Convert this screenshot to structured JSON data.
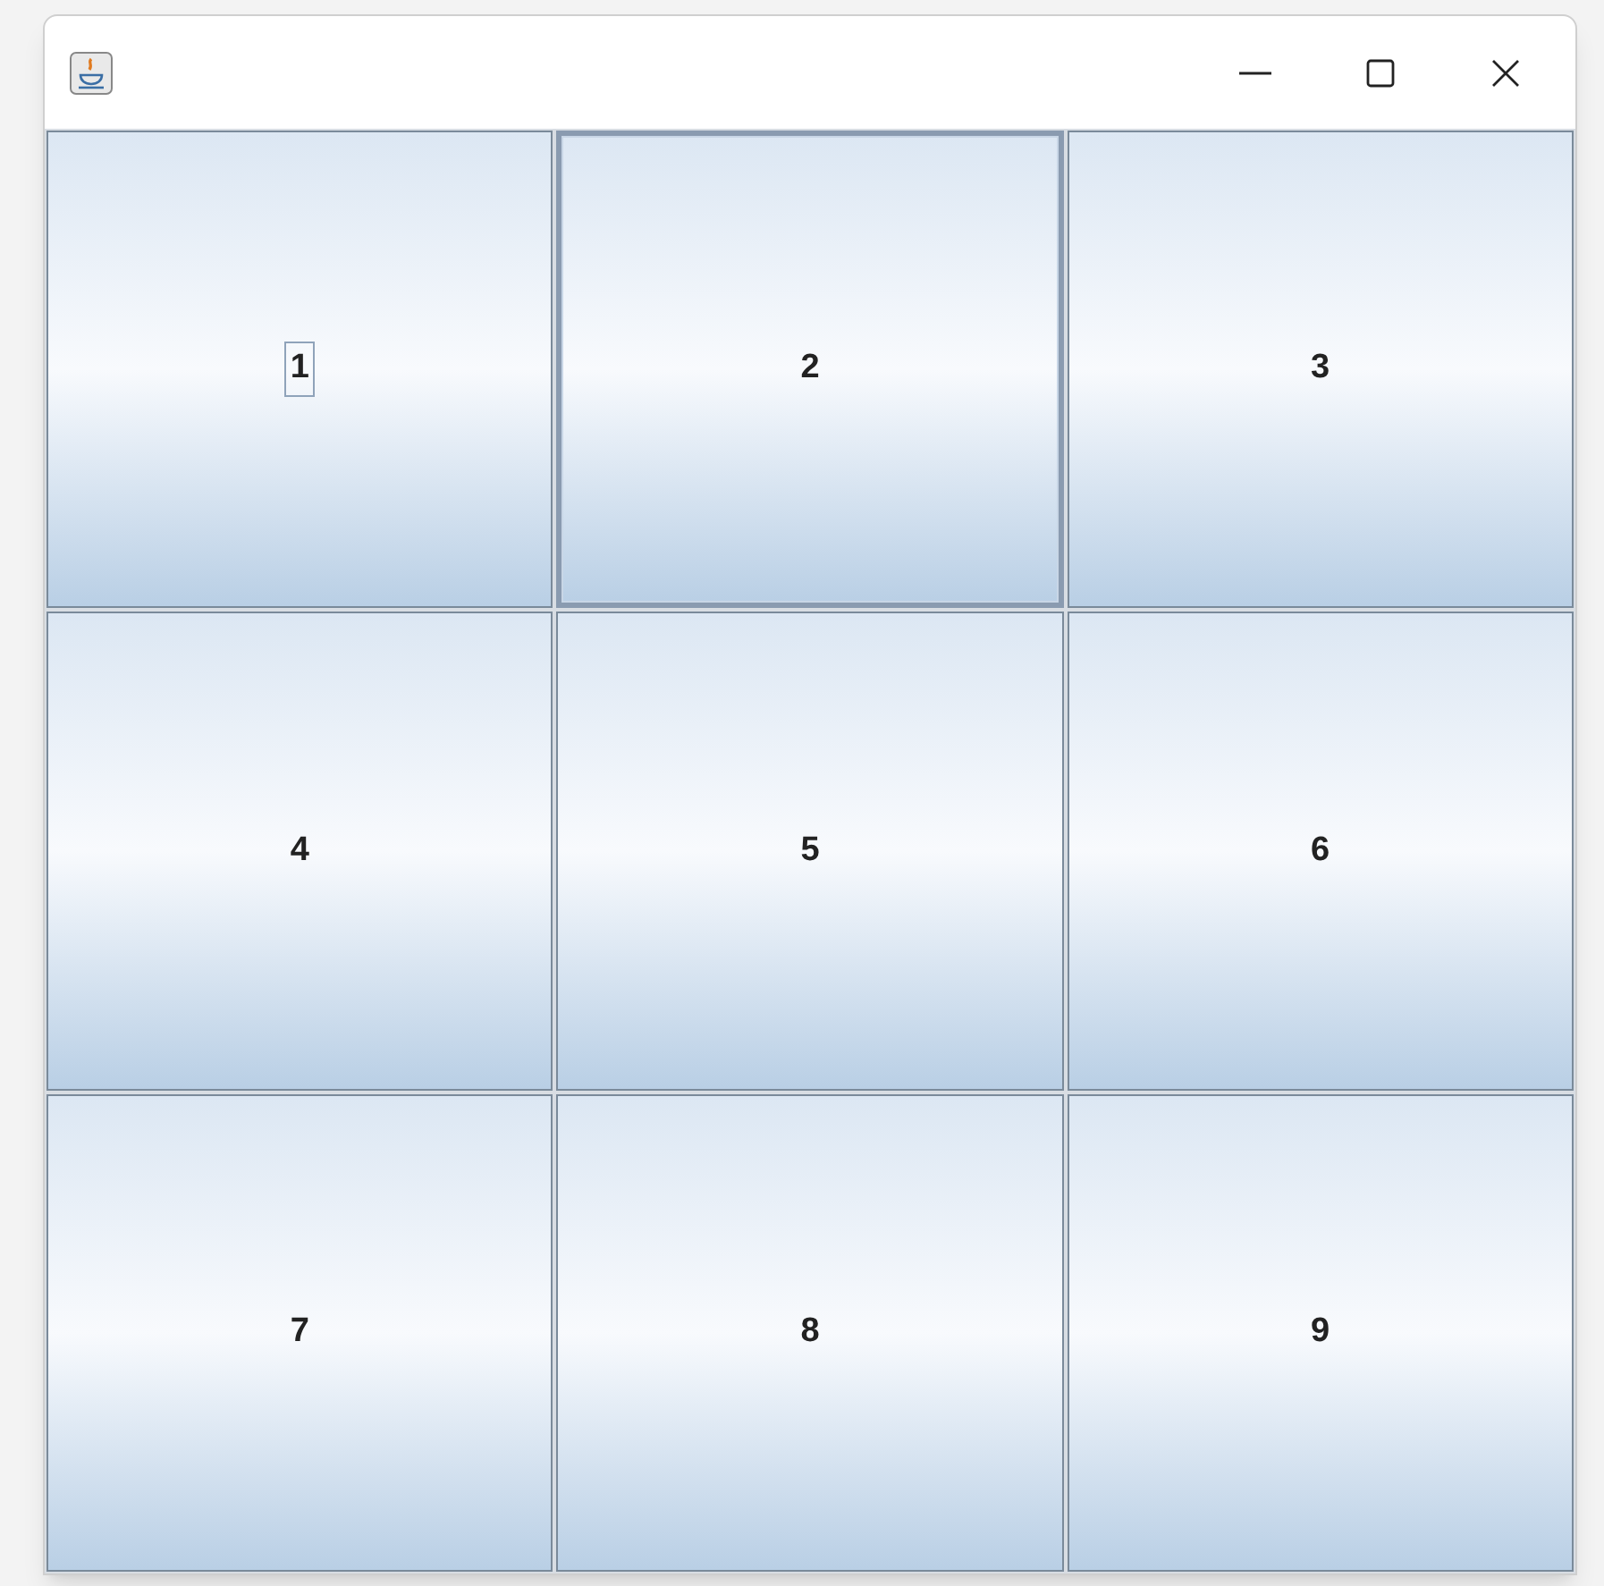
{
  "window": {
    "controls": [
      {
        "kind": "minimize"
      },
      {
        "kind": "maximize"
      },
      {
        "kind": "close"
      }
    ]
  },
  "buttons": [
    {
      "label": "1",
      "focused": true,
      "hovered": false
    },
    {
      "label": "2",
      "focused": false,
      "hovered": true
    },
    {
      "label": "3",
      "focused": false,
      "hovered": false
    },
    {
      "label": "4",
      "focused": false,
      "hovered": false
    },
    {
      "label": "5",
      "focused": false,
      "hovered": false
    },
    {
      "label": "6",
      "focused": false,
      "hovered": false
    },
    {
      "label": "7",
      "focused": false,
      "hovered": false
    },
    {
      "label": "8",
      "focused": false,
      "hovered": false
    },
    {
      "label": "9",
      "focused": false,
      "hovered": false
    }
  ]
}
